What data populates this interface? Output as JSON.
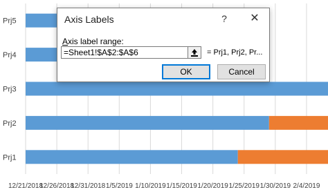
{
  "chart_data": {
    "type": "bar",
    "orientation": "horizontal",
    "stacked": true,
    "categories": [
      "Prj1",
      "Prj2",
      "Prj3",
      "Prj4",
      "Prj5"
    ],
    "series": [
      {
        "values": [
          34,
          39,
          50,
          14,
          13
        ],
        "color": "#5b9bd5"
      },
      {
        "values": [
          18,
          12,
          8,
          0,
          1
        ],
        "color": "#ed7d31"
      }
    ],
    "x_ticks": [
      "12/21/2018",
      "12/26/2018",
      "12/31/2018",
      "1/5/2019",
      "1/10/2019",
      "1/15/2019",
      "1/20/2019",
      "1/25/2019",
      "1/30/2019",
      "2/4/2019"
    ],
    "x_tick_days": [
      0,
      5,
      10,
      15,
      20,
      25,
      30,
      35,
      40,
      45
    ],
    "xlim": [
      0,
      47
    ],
    "grid": true,
    "legend": false
  },
  "dialog": {
    "title": "Axis Labels",
    "help_label": "?",
    "close_label": "✕",
    "field_mnemonic": "A",
    "field_label_rest": "xis label range:",
    "range_value": "=Sheet1!$A$2:$A$6",
    "preview": "= Prj1, Prj2, Pr...",
    "ok_label": "OK",
    "cancel_label": "Cancel",
    "collapse_icon": "collapse-dialog-icon"
  }
}
